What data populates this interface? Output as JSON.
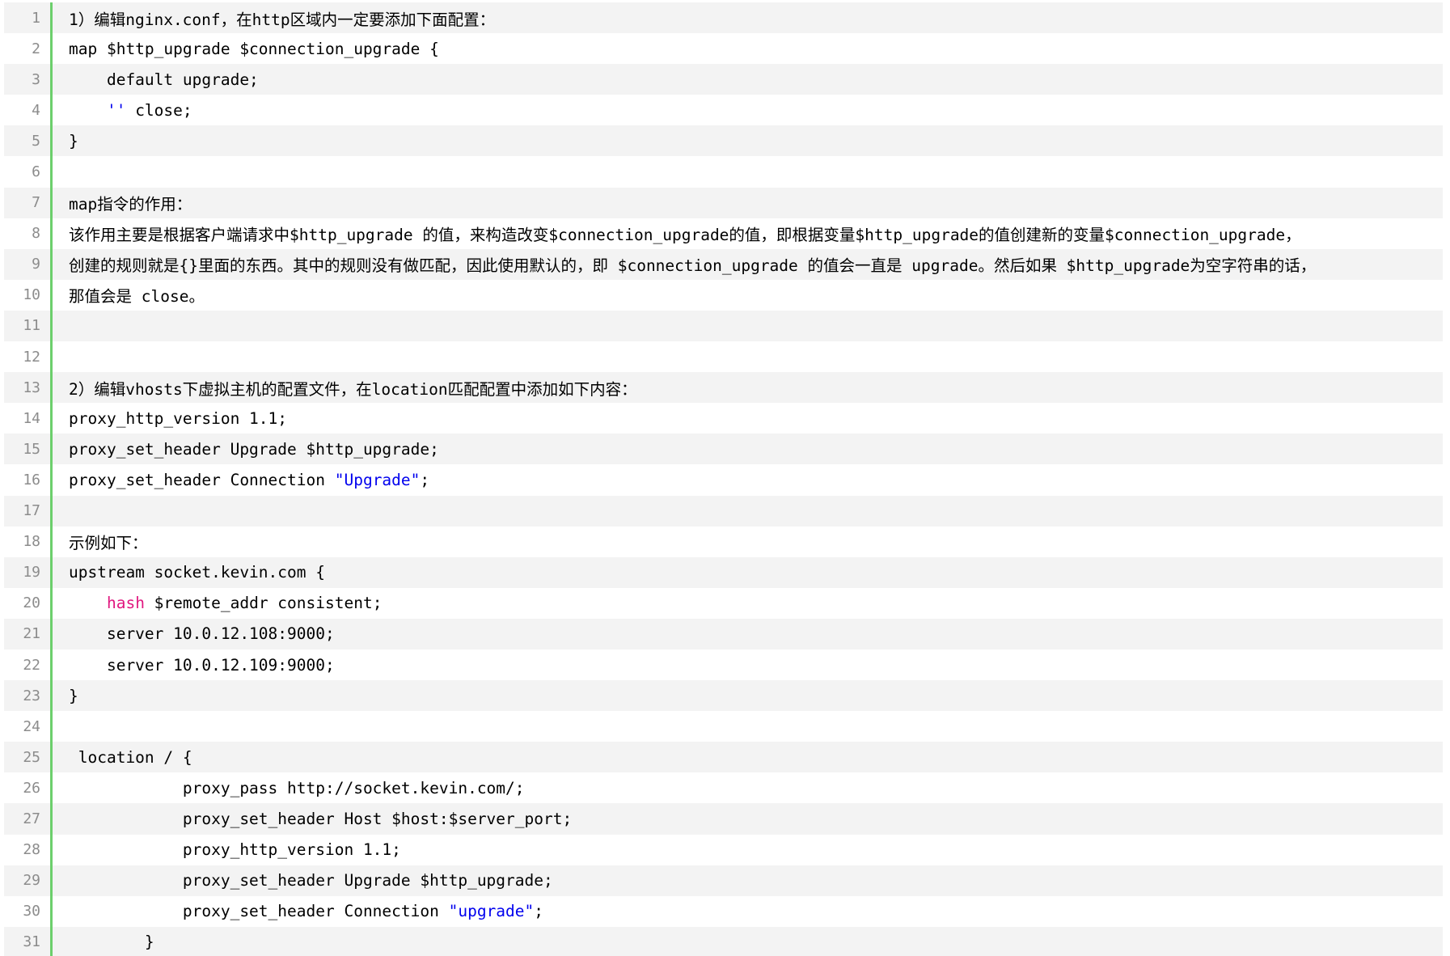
{
  "colors": {
    "text": "#000000",
    "line_number": "#8c8c8c",
    "string": "#0000ee",
    "keyword": "#e0177f",
    "gutter_border": "#6ccf6c",
    "alt_row": "#f3f3f3"
  },
  "code": {
    "lines": [
      {
        "n": "1",
        "tokens": [
          {
            "t": "1）编辑nginx.conf，在http区域内一定要添加下面配置："
          }
        ]
      },
      {
        "n": "2",
        "tokens": [
          {
            "t": "map $http_upgrade $connection_upgrade {"
          }
        ]
      },
      {
        "n": "3",
        "tokens": [
          {
            "t": "    default upgrade;"
          }
        ]
      },
      {
        "n": "4",
        "tokens": [
          {
            "t": "    "
          },
          {
            "t": "''",
            "k": "string"
          },
          {
            "t": " close;"
          }
        ]
      },
      {
        "n": "5",
        "tokens": [
          {
            "t": "}"
          }
        ]
      },
      {
        "n": "6",
        "tokens": [
          {
            "t": ""
          }
        ]
      },
      {
        "n": "7",
        "tokens": [
          {
            "t": "map指令的作用："
          }
        ]
      },
      {
        "n": "8",
        "tokens": [
          {
            "t": "该作用主要是根据客户端请求中$http_upgrade 的值，来构造改变$connection_upgrade的值，即根据变量$http_upgrade的值创建新的变量$connection_upgrade，"
          }
        ]
      },
      {
        "n": "9",
        "tokens": [
          {
            "t": "创建的规则就是{}里面的东西。其中的规则没有做匹配，因此使用默认的，即 $connection_upgrade 的值会一直是 upgrade。然后如果 $http_upgrade为空字符串的话，"
          }
        ]
      },
      {
        "n": "10",
        "tokens": [
          {
            "t": "那值会是 close。"
          }
        ]
      },
      {
        "n": "11",
        "tokens": [
          {
            "t": ""
          }
        ]
      },
      {
        "n": "12",
        "tokens": [
          {
            "t": ""
          }
        ]
      },
      {
        "n": "13",
        "tokens": [
          {
            "t": "2）编辑vhosts下虚拟主机的配置文件，在location匹配配置中添加如下内容："
          }
        ]
      },
      {
        "n": "14",
        "tokens": [
          {
            "t": "proxy_http_version 1.1;"
          }
        ]
      },
      {
        "n": "15",
        "tokens": [
          {
            "t": "proxy_set_header Upgrade $http_upgrade;"
          }
        ]
      },
      {
        "n": "16",
        "tokens": [
          {
            "t": "proxy_set_header Connection "
          },
          {
            "t": "\"Upgrade\"",
            "k": "string"
          },
          {
            "t": ";"
          }
        ]
      },
      {
        "n": "17",
        "tokens": [
          {
            "t": ""
          }
        ]
      },
      {
        "n": "18",
        "tokens": [
          {
            "t": "示例如下："
          }
        ]
      },
      {
        "n": "19",
        "tokens": [
          {
            "t": "upstream socket.kevin.com {"
          }
        ]
      },
      {
        "n": "20",
        "tokens": [
          {
            "t": "    "
          },
          {
            "t": "hash",
            "k": "keyword"
          },
          {
            "t": " $remote_addr consistent;"
          }
        ]
      },
      {
        "n": "21",
        "tokens": [
          {
            "t": "    server 10.0.12.108:9000;"
          }
        ]
      },
      {
        "n": "22",
        "tokens": [
          {
            "t": "    server 10.0.12.109:9000;"
          }
        ]
      },
      {
        "n": "23",
        "tokens": [
          {
            "t": "}"
          }
        ]
      },
      {
        "n": "24",
        "tokens": [
          {
            "t": ""
          }
        ]
      },
      {
        "n": "25",
        "tokens": [
          {
            "t": " location / {"
          }
        ]
      },
      {
        "n": "26",
        "tokens": [
          {
            "t": "            proxy_pass http://socket.kevin.com/;"
          }
        ]
      },
      {
        "n": "27",
        "tokens": [
          {
            "t": "            proxy_set_header Host $host:$server_port;"
          }
        ]
      },
      {
        "n": "28",
        "tokens": [
          {
            "t": "            proxy_http_version 1.1;"
          }
        ]
      },
      {
        "n": "29",
        "tokens": [
          {
            "t": "            proxy_set_header Upgrade $http_upgrade;"
          }
        ]
      },
      {
        "n": "30",
        "tokens": [
          {
            "t": "            proxy_set_header Connection "
          },
          {
            "t": "\"upgrade\"",
            "k": "string"
          },
          {
            "t": ";"
          }
        ]
      },
      {
        "n": "31",
        "tokens": [
          {
            "t": "        }"
          }
        ]
      }
    ]
  }
}
